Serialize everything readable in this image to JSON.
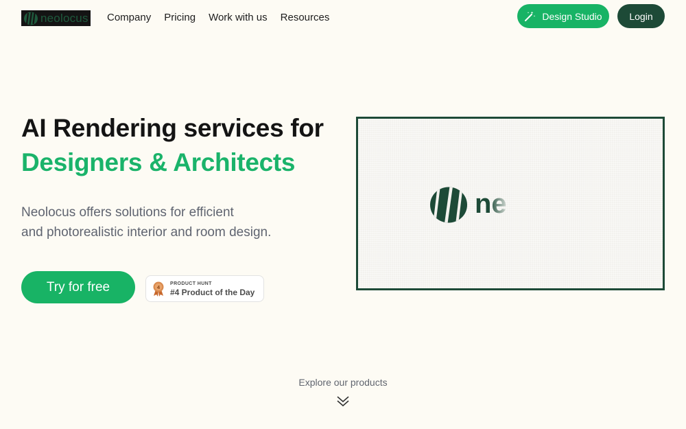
{
  "header": {
    "logo_text": "neolocus",
    "nav": [
      "Company",
      "Pricing",
      "Work with us",
      "Resources"
    ],
    "design_studio_label": "Design Studio",
    "login_label": "Login"
  },
  "hero": {
    "title_line1": "AI Rendering services for",
    "title_line2": "Designers & Architects",
    "description_line1": "Neolocus offers solutions for efficient",
    "description_line2": "and photorealistic interior and room design.",
    "cta_label": "Try for free",
    "badge": {
      "small_label": "PRODUCT HUNT",
      "big_label": "#4 Product of the Day",
      "medal_number": "4"
    }
  },
  "video": {
    "logo_text": "ne"
  },
  "explore": {
    "label": "Explore our products"
  },
  "colors": {
    "accent_green": "#18b365",
    "dark_green": "#1d4a37",
    "background": "#fdfbf4",
    "medal_orange": "#d27b3c"
  },
  "icons": {
    "design_studio": "magic-wand-icon",
    "explore": "double-chevron-down-icon",
    "badge": "medal-icon"
  }
}
